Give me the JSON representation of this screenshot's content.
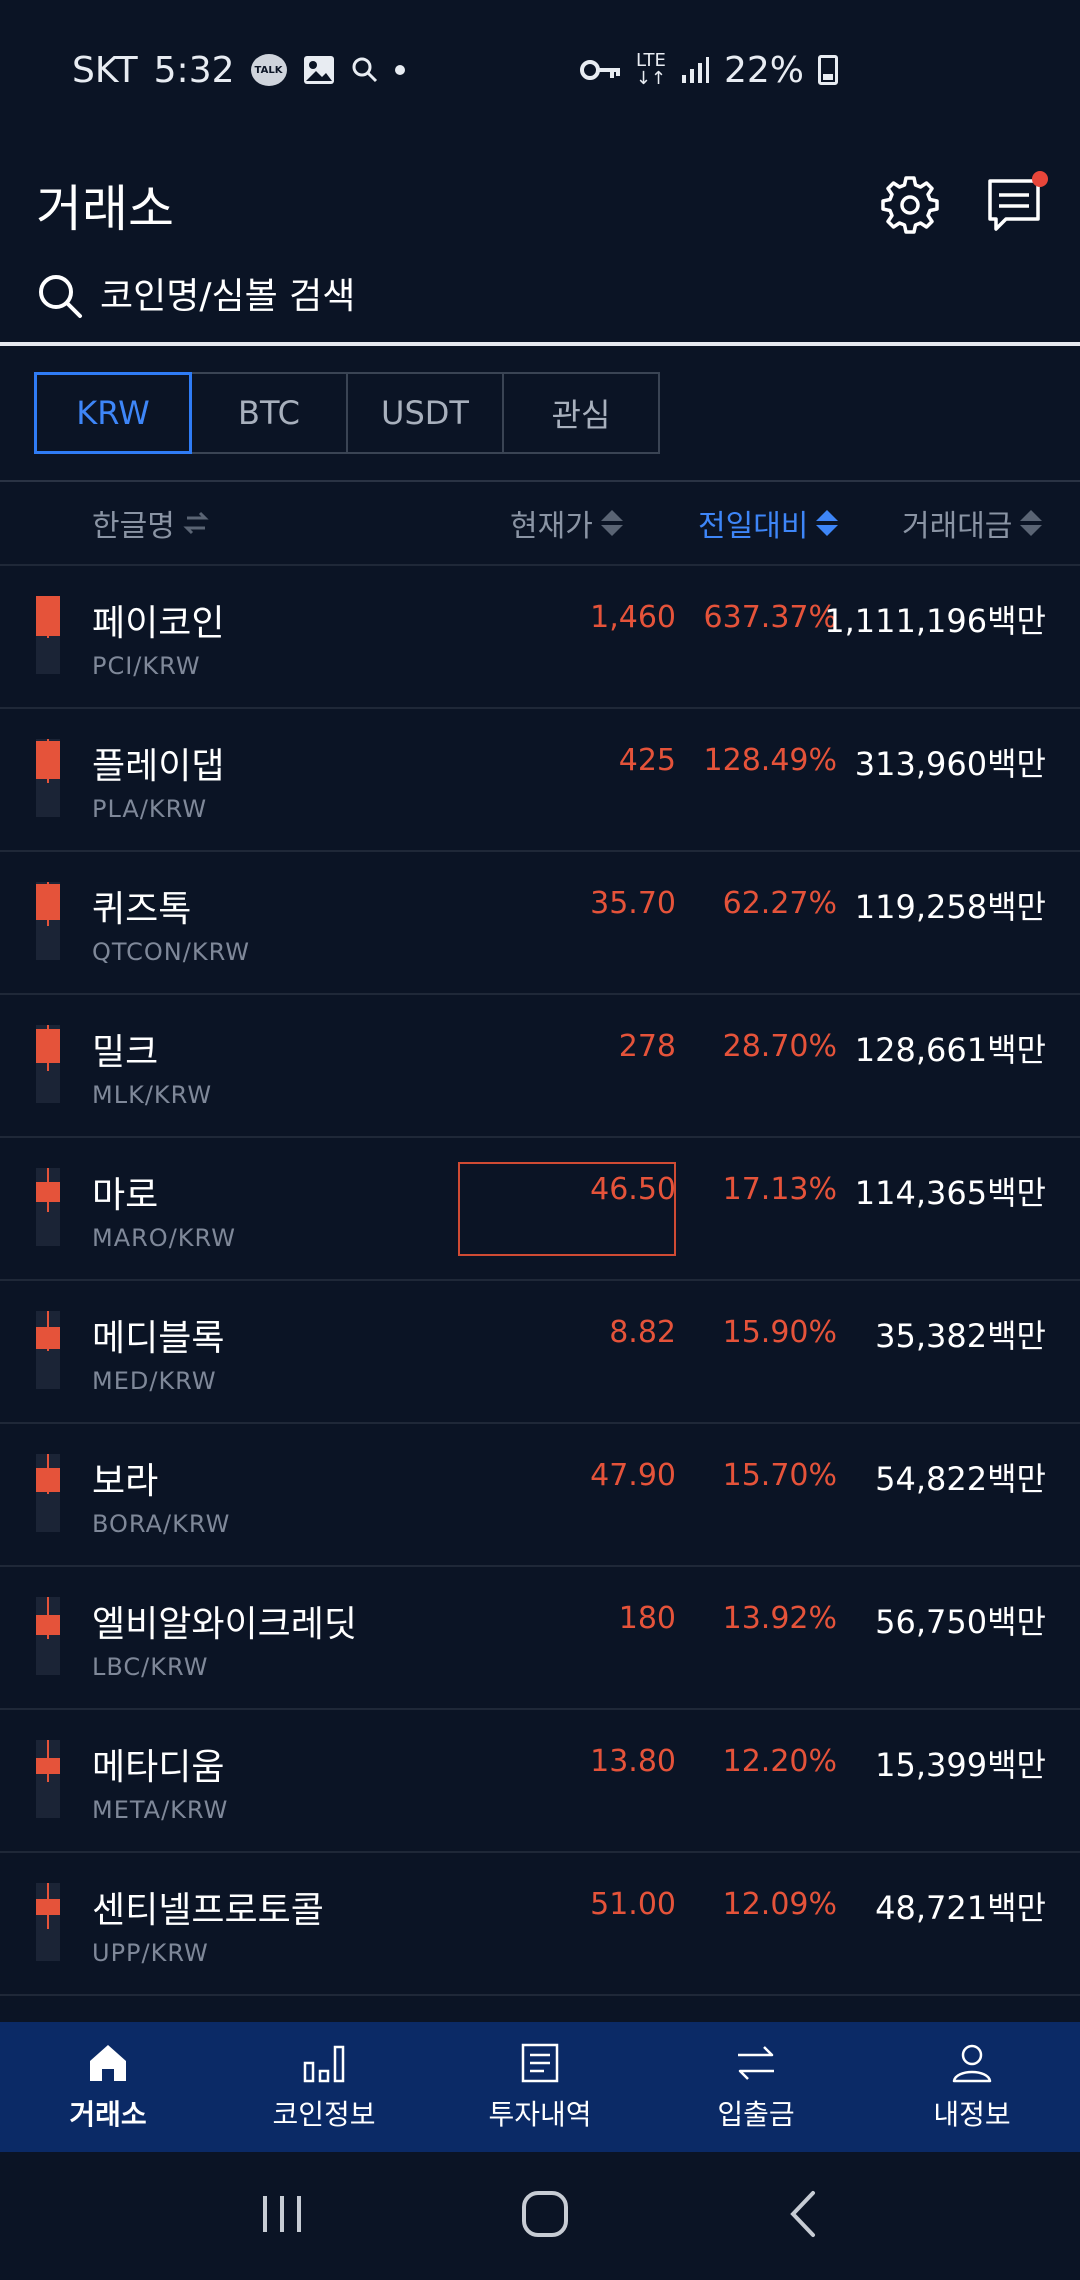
{
  "status_bar": {
    "carrier": "SKT",
    "time": "5:32",
    "talk_label": "TALK",
    "network_top": "LTE",
    "network_bottom": "↓↑",
    "battery": "22%"
  },
  "header": {
    "title": "거래소"
  },
  "search": {
    "placeholder": "코인명/심볼 검색"
  },
  "market_tabs": [
    {
      "label": "KRW",
      "active": true
    },
    {
      "label": "BTC",
      "active": false
    },
    {
      "label": "USDT",
      "active": false
    },
    {
      "label": "관심",
      "active": false
    }
  ],
  "columns": {
    "name": "한글명",
    "price": "현재가",
    "change": "전일대비",
    "volume": "거래대금"
  },
  "rows": [
    {
      "name": "페이코인",
      "symbol": "PCI/KRW",
      "price": "1,460",
      "change": "637.37%",
      "volume": "1,111,196백만"
    },
    {
      "name": "플레이댑",
      "symbol": "PLA/KRW",
      "price": "425",
      "change": "128.49%",
      "volume": "313,960백만"
    },
    {
      "name": "퀴즈톡",
      "symbol": "QTCON/KRW",
      "price": "35.70",
      "change": "62.27%",
      "volume": "119,258백만"
    },
    {
      "name": "밀크",
      "symbol": "MLK/KRW",
      "price": "278",
      "change": "28.70%",
      "volume": "128,661백만"
    },
    {
      "name": "마로",
      "symbol": "MARO/KRW",
      "price": "46.50",
      "change": "17.13%",
      "volume": "114,365백만"
    },
    {
      "name": "메디블록",
      "symbol": "MED/KRW",
      "price": "8.82",
      "change": "15.90%",
      "volume": "35,382백만"
    },
    {
      "name": "보라",
      "symbol": "BORA/KRW",
      "price": "47.90",
      "change": "15.70%",
      "volume": "54,822백만"
    },
    {
      "name": "엘비알와이크레딧",
      "symbol": "LBC/KRW",
      "price": "180",
      "change": "13.92%",
      "volume": "56,750백만"
    },
    {
      "name": "메타디움",
      "symbol": "META/KRW",
      "price": "13.80",
      "change": "12.20%",
      "volume": "15,399백만"
    },
    {
      "name": "센티넬프로토콜",
      "symbol": "UPP/KRW",
      "price": "51.00",
      "change": "12.09%",
      "volume": "48,721백만"
    }
  ],
  "bottom_nav": [
    {
      "label": "거래소",
      "icon": "home-icon",
      "active": true
    },
    {
      "label": "코인정보",
      "icon": "bar-chart-icon",
      "active": false
    },
    {
      "label": "투자내역",
      "icon": "document-icon",
      "active": false
    },
    {
      "label": "입출금",
      "icon": "transfer-icon",
      "active": false
    },
    {
      "label": "내정보",
      "icon": "user-icon",
      "active": false
    }
  ],
  "colors": {
    "background": "#0b1425",
    "rise": "#e5533a",
    "accent": "#2f7cf6",
    "nav_bg": "#0b2a66"
  }
}
